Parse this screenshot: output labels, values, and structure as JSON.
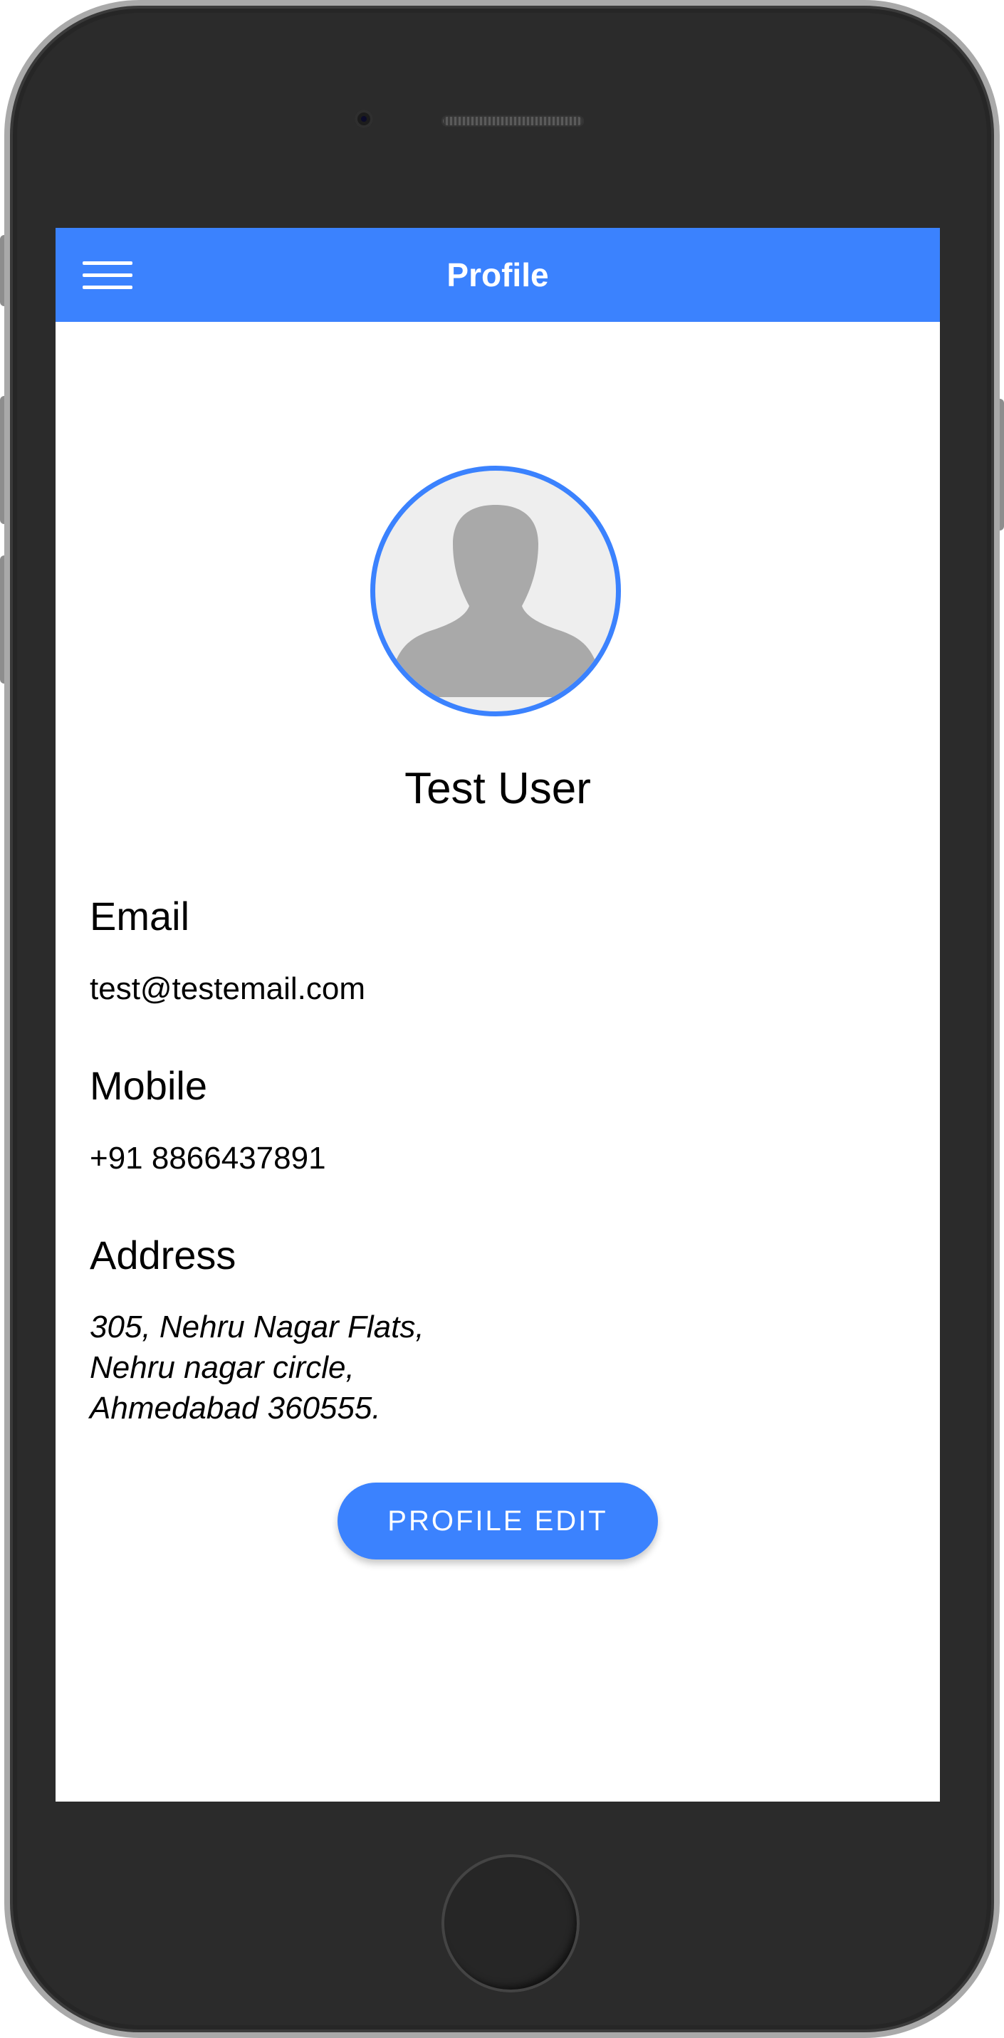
{
  "app_bar": {
    "title": "Profile",
    "menu_icon": "hamburger-menu-icon",
    "color": "#3b82fe"
  },
  "profile": {
    "avatar_icon": "person-silhouette-icon",
    "name": "Test User"
  },
  "fields": {
    "email": {
      "label": "Email",
      "value": "test@testemail.com"
    },
    "mobile": {
      "label": "Mobile",
      "value": "+91 8866437891"
    },
    "address": {
      "label": "Address",
      "lines": [
        "305, Nehru Nagar Flats,",
        "Nehru nagar circle,",
        "Ahmedabad 360555."
      ]
    }
  },
  "actions": {
    "edit_label": "PROFILE EDIT"
  },
  "colors": {
    "accent": "#3b82fe",
    "avatar_background": "#eeeeee",
    "avatar_silhouette": "#a9a9a9",
    "device_body": "#2b2b2b"
  }
}
